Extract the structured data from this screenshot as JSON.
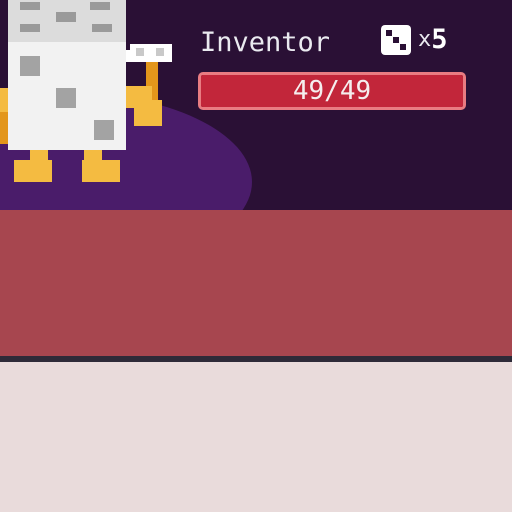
{
  "character": {
    "name": "Inventor",
    "sprite_icon": "inventor-sprite",
    "tool_icon": "hammer-icon"
  },
  "dice": {
    "icon": "dice-icon",
    "multiplier": "x",
    "count": "5"
  },
  "hp": {
    "current": 49,
    "max": 49,
    "text": "49/49",
    "fill_fraction": 1.0
  },
  "colors": {
    "top_panel": "#2a1035",
    "spotlight": "#4a1c6a",
    "hp_fill": "#c2263a",
    "hp_border": "#e97c82",
    "mid_band": "#a7464f",
    "divider": "#2e2a38",
    "bottom_panel": "#e9dbdb"
  }
}
